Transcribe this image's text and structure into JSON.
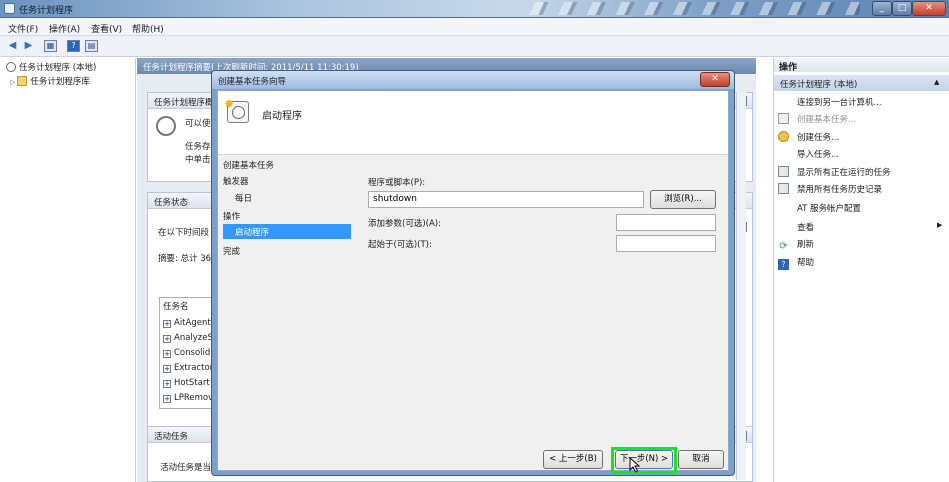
{
  "window": {
    "title": "任务计划程序"
  },
  "menu": [
    "文件(F)",
    "操作(A)",
    "查看(V)",
    "帮助(H)"
  ],
  "tree": {
    "root": "任务计划程序 (本地)",
    "child": "任务计划程序库"
  },
  "center": {
    "header": "任务计划程序摘要(上次刷新时间: 2011/5/11 11:30:19)",
    "overview_header": "任务计划程序概",
    "overview_text_1": "可以使",
    "overview_text_2": "任务存",
    "overview_text_3": "中单击",
    "status_header": "任务状态",
    "status_line": "在以下时间段",
    "summary_line": "摘要: 总计 36",
    "task_col": "任务名",
    "tasks": [
      "AitAgent",
      "AnalyzeS",
      "Consolid",
      "Extractor",
      "HotStart",
      "LPRemov"
    ],
    "active_header": "活动任务",
    "active_line": "活动任务是当"
  },
  "actions": {
    "header": "操作",
    "subheader": "任务计划程序 (本地)",
    "items": [
      {
        "label": "连接到另一台计算机...",
        "icon": "none",
        "disabled": false
      },
      {
        "label": "创建基本任务...",
        "icon": "wizard-icon",
        "disabled": true
      },
      {
        "label": "创建任务...",
        "icon": "create-task-icon",
        "disabled": false
      },
      {
        "label": "导入任务...",
        "icon": "none",
        "disabled": false
      },
      {
        "label": "显示所有正在运行的任务",
        "icon": "running-tasks-icon",
        "disabled": false
      },
      {
        "label": "禁用所有任务历史记录",
        "icon": "history-icon",
        "disabled": false
      },
      {
        "label": "AT 服务帐户配置",
        "icon": "none",
        "disabled": false
      },
      {
        "label": "查看",
        "icon": "none",
        "disabled": false
      },
      {
        "label": "刷新",
        "icon": "refresh-icon",
        "disabled": false
      },
      {
        "label": "帮助",
        "icon": "help-icon",
        "disabled": false
      }
    ]
  },
  "dialog": {
    "title": "创建基本任务向导",
    "heading": "启动程序",
    "steps": {
      "create": "创建基本任务",
      "trigger": "触发器",
      "daily": "每日",
      "action": "操作",
      "start_program": "启动程序",
      "finish": "完成"
    },
    "program_label": "程序或脚本(P):",
    "program_value": "shutdown",
    "browse": "浏览(R)...",
    "args_label": "添加参数(可选)(A):",
    "start_in_label": "起始于(可选)(T):",
    "back": "< 上一步(B)",
    "next": "下一步(N) >",
    "cancel": "取消"
  },
  "colors": {
    "highlight": "#22e024",
    "selection": "#3399ff"
  }
}
